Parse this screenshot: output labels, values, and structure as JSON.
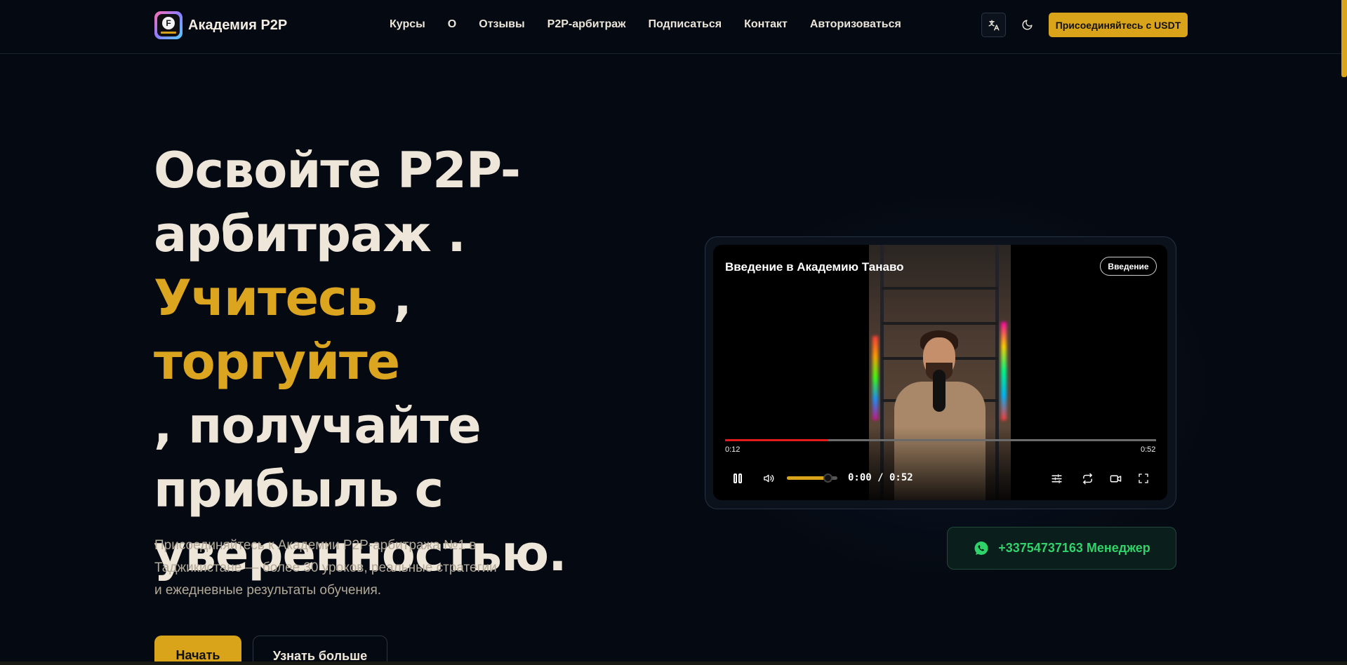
{
  "colors": {
    "accent": "#d9a31a",
    "background": "#050a12",
    "whatsapp": "#2fd36a",
    "progress": "#e41b1b"
  },
  "brand": {
    "name": "Академия P2P",
    "logo_icon": "academy-logo-icon"
  },
  "nav": {
    "items": [
      "Курсы",
      "О",
      "Отзывы",
      "P2P-арбитраж",
      "Подписаться",
      "Контакт",
      "Авторизоваться"
    ]
  },
  "header": {
    "translate_icon": "translate-icon",
    "theme_icon": "moon-icon",
    "join_button": "Присоединяйтесь с USDT"
  },
  "hero": {
    "title_part1": "Освойте P2P-арбитраж .",
    "title_highlight1": "Учитесь",
    "title_sep": " , ",
    "title_highlight2": "торгуйте",
    "title_part2": ", получайте прибыль с уверенностью.",
    "description": "Присоединяйтесь к Академии P2P-арбитража №1 в Таджикистане — более 30 уроков, реальные стратегии и ежедневные результаты обучения.",
    "primary_button": "Начать",
    "secondary_button": "Узнать больше"
  },
  "video": {
    "title": "Введение в Академию Танаво",
    "badge": "Введение",
    "time_start": "0:12",
    "time_end": "0:52",
    "time_readout": "0:00 / 0:52",
    "progress_fraction": 0.24,
    "volume_fraction": 0.8
  },
  "whatsapp": {
    "label": "+33754737163 Менеджер",
    "icon": "whatsapp-icon"
  }
}
